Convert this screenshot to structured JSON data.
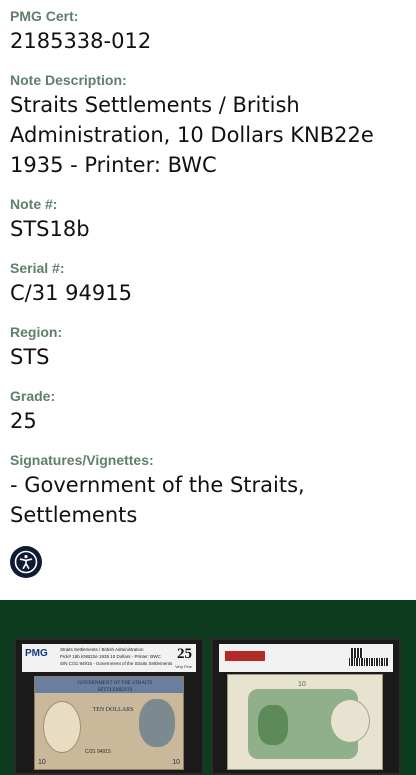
{
  "fields": [
    {
      "label": "PMG Cert:",
      "value": "2185338-012"
    },
    {
      "label": "Note Description:",
      "value": "Straits Settlements / British Administration, 10 Dollars KNB22e 1935 - Printer: BWC"
    },
    {
      "label": "Note #:",
      "value": "STS18b"
    },
    {
      "label": "Serial #:",
      "value": "C/31 94915"
    },
    {
      "label": "Region:",
      "value": "STS"
    },
    {
      "label": "Grade:",
      "value": "25"
    },
    {
      "label": "Signatures/Vignettes:",
      "value": "- Government of the Straits, Settlements"
    }
  ],
  "accessibility": {
    "icon": "accessibility-icon"
  },
  "colors": {
    "label": "#5f7f6a",
    "gallery_bg": "#0d3d1e",
    "a11y_btn": "#0f1a33"
  },
  "slab_front": {
    "logo": "PMG",
    "line1": "Straits Settlements / British Administration",
    "line2": "Pick# 18b KNB22e      1935  10 Dollars - Printer: BWC",
    "line3": "S/N C/31 94915  - Government of the Straits Settlements",
    "grade": "25",
    "grade_word": "Very Fine",
    "note_header": "GOVERNMENT OF THE STRAITS SETTLEMENTS",
    "note_denom": "TEN DOLLARS",
    "note_num": "10",
    "note_serial": "C/31 94915"
  },
  "slab_back": {
    "note_num": "10"
  }
}
